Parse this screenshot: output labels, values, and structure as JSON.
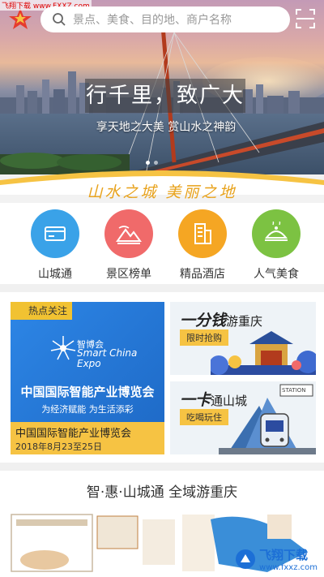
{
  "watermark_top": "飞翔下载 www.FXXZ.com",
  "search": {
    "placeholder": "景点、美食、目的地、商户名称"
  },
  "hero": {
    "title": "行千里，致广大",
    "subtitle": "享天地之大美 赏山水之神韵",
    "dots": 2,
    "active_dot": 0
  },
  "slogan": "山水之城 美丽之地",
  "quick": [
    {
      "label": "山城通",
      "icon": "card-icon",
      "color": "#3aa2e8"
    },
    {
      "label": "景区榜单",
      "icon": "mountain-icon",
      "color": "#f06a6a"
    },
    {
      "label": "精品酒店",
      "icon": "building-icon",
      "color": "#f5a623"
    },
    {
      "label": "人气美食",
      "icon": "dish-icon",
      "color": "#7cc242"
    }
  ],
  "expo": {
    "tag": "热点关注",
    "logo_name": "智博会",
    "logo_en": "Smart China Expo",
    "title": "中国国际智能产业博览会",
    "sub": "为经济赋能 为生活添彩",
    "footer_title": "中国国际智能产业博览会",
    "footer_date": "2018年8月23至25日"
  },
  "card1": {
    "prefix": "一分钱",
    "suffix": "游重庆",
    "pill": "限时抢购"
  },
  "card2": {
    "prefix": "一卡",
    "suffix": "通山城",
    "pill": "吃喝玩住",
    "station": "STATION"
  },
  "bottom_title": "智·惠·山城通 全域游重庆",
  "watermark_bottom": {
    "title": "飞翔下载",
    "url": "www.fxxz.com"
  },
  "colors": {
    "accent_yellow": "#f6c343",
    "slogan": "#e8a21b",
    "expo_blue": "#2a7ad6"
  }
}
